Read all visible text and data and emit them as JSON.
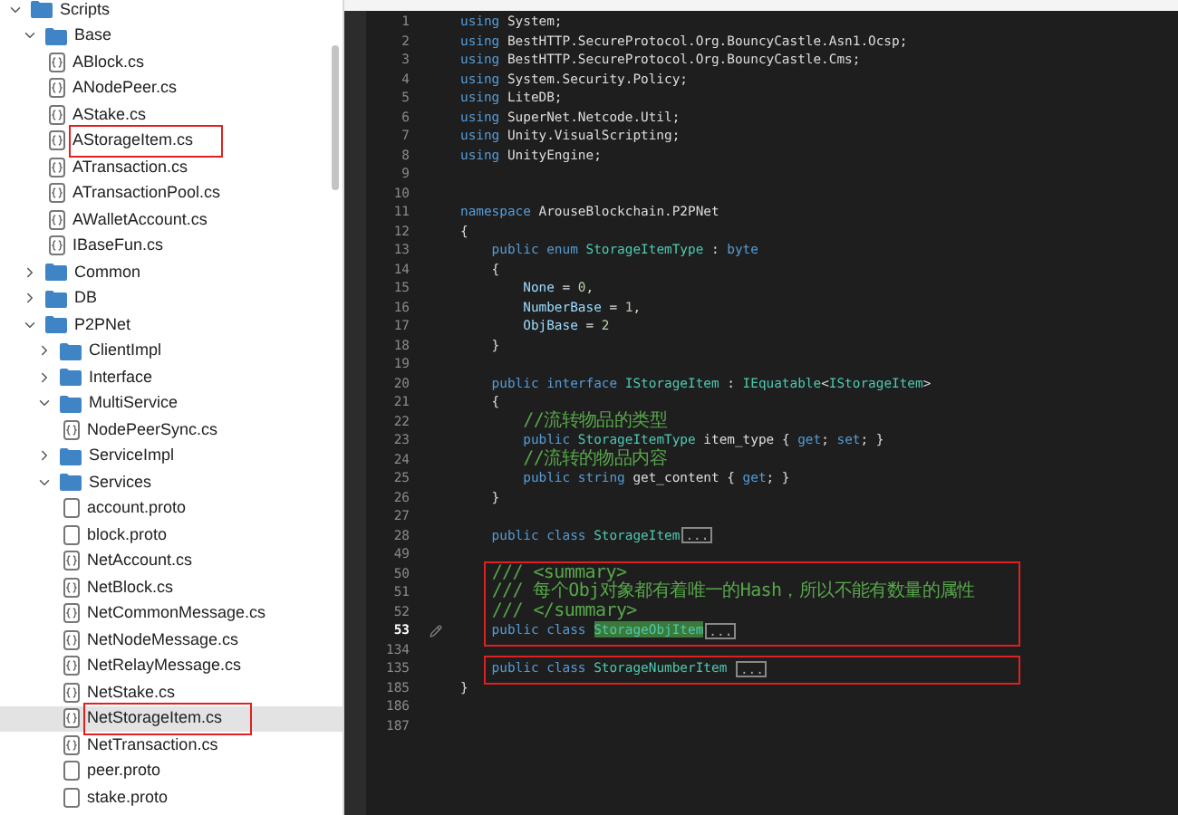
{
  "tree": [
    {
      "label": "Scripts",
      "kind": "folder",
      "expanded": true,
      "selected": false,
      "boxed": false,
      "children": [
        {
          "label": "Base",
          "kind": "folder",
          "expanded": true,
          "selected": false,
          "boxed": false,
          "children": [
            {
              "label": "ABlock.cs",
              "kind": "cs",
              "selected": false,
              "boxed": false
            },
            {
              "label": "ANodePeer.cs",
              "kind": "cs",
              "selected": false,
              "boxed": false
            },
            {
              "label": "AStake.cs",
              "kind": "cs",
              "selected": false,
              "boxed": false
            },
            {
              "label": "AStorageItem.cs",
              "kind": "cs",
              "selected": false,
              "boxed": true
            },
            {
              "label": "ATransaction.cs",
              "kind": "cs",
              "selected": false,
              "boxed": false
            },
            {
              "label": "ATransactionPool.cs",
              "kind": "cs",
              "selected": false,
              "boxed": false
            },
            {
              "label": "AWalletAccount.cs",
              "kind": "cs",
              "selected": false,
              "boxed": false
            },
            {
              "label": "IBaseFun.cs",
              "kind": "cs",
              "selected": false,
              "boxed": false
            }
          ]
        },
        {
          "label": "Common",
          "kind": "folder",
          "expanded": false,
          "selected": false,
          "boxed": false
        },
        {
          "label": "DB",
          "kind": "folder",
          "expanded": false,
          "selected": false,
          "boxed": false
        },
        {
          "label": "P2PNet",
          "kind": "folder",
          "expanded": true,
          "selected": false,
          "boxed": false,
          "children": [
            {
              "label": "ClientImpl",
              "kind": "folder",
              "expanded": false,
              "selected": false,
              "boxed": false
            },
            {
              "label": "Interface",
              "kind": "folder",
              "expanded": false,
              "selected": false,
              "boxed": false
            },
            {
              "label": "MultiService",
              "kind": "folder",
              "expanded": true,
              "selected": false,
              "boxed": false,
              "children": [
                {
                  "label": "NodePeerSync.cs",
                  "kind": "cs",
                  "selected": false,
                  "boxed": false
                }
              ]
            },
            {
              "label": "ServiceImpl",
              "kind": "folder",
              "expanded": false,
              "selected": false,
              "boxed": false
            },
            {
              "label": "Services",
              "kind": "folder",
              "expanded": true,
              "selected": false,
              "boxed": false,
              "children": [
                {
                  "label": "account.proto",
                  "kind": "proto",
                  "selected": false,
                  "boxed": false
                },
                {
                  "label": "block.proto",
                  "kind": "proto",
                  "selected": false,
                  "boxed": false
                },
                {
                  "label": "NetAccount.cs",
                  "kind": "cs",
                  "selected": false,
                  "boxed": false
                },
                {
                  "label": "NetBlock.cs",
                  "kind": "cs",
                  "selected": false,
                  "boxed": false
                },
                {
                  "label": "NetCommonMessage.cs",
                  "kind": "cs",
                  "selected": false,
                  "boxed": false
                },
                {
                  "label": "NetNodeMessage.cs",
                  "kind": "cs",
                  "selected": false,
                  "boxed": false
                },
                {
                  "label": "NetRelayMessage.cs",
                  "kind": "cs",
                  "selected": false,
                  "boxed": false
                },
                {
                  "label": "NetStake.cs",
                  "kind": "cs",
                  "selected": false,
                  "boxed": false
                },
                {
                  "label": "NetStorageItem.cs",
                  "kind": "cs",
                  "selected": true,
                  "boxed": true
                },
                {
                  "label": "NetTransaction.cs",
                  "kind": "cs",
                  "selected": false,
                  "boxed": false
                },
                {
                  "label": "peer.proto",
                  "kind": "proto",
                  "selected": false,
                  "boxed": false
                },
                {
                  "label": "stake.proto",
                  "kind": "proto",
                  "selected": false,
                  "boxed": false
                }
              ]
            }
          ]
        }
      ]
    }
  ],
  "editor": {
    "blocks": [
      {
        "boxed": false,
        "lines": [
          {
            "number": "1",
            "current": false,
            "tokens": [
              {
                "text": "using",
                "kind": "kw"
              },
              {
                "text": " System;",
                "kind": "plain"
              }
            ]
          },
          {
            "number": "2",
            "current": false,
            "tokens": [
              {
                "text": "using",
                "kind": "kw"
              },
              {
                "text": " BestHTTP.SecureProtocol.Org.BouncyCastle.Asn1.Ocsp;",
                "kind": "plain"
              }
            ]
          },
          {
            "number": "3",
            "current": false,
            "tokens": [
              {
                "text": "using",
                "kind": "kw"
              },
              {
                "text": " BestHTTP.SecureProtocol.Org.BouncyCastle.Cms;",
                "kind": "plain"
              }
            ]
          },
          {
            "number": "4",
            "current": false,
            "tokens": [
              {
                "text": "using",
                "kind": "kw"
              },
              {
                "text": " System.Security.Policy;",
                "kind": "plain"
              }
            ]
          },
          {
            "number": "5",
            "current": false,
            "tokens": [
              {
                "text": "using",
                "kind": "kw"
              },
              {
                "text": " LiteDB;",
                "kind": "plain"
              }
            ]
          },
          {
            "number": "6",
            "current": false,
            "tokens": [
              {
                "text": "using",
                "kind": "kw"
              },
              {
                "text": " SuperNet.Netcode.Util;",
                "kind": "plain"
              }
            ]
          },
          {
            "number": "7",
            "current": false,
            "tokens": [
              {
                "text": "using",
                "kind": "kw"
              },
              {
                "text": " Unity.VisualScripting;",
                "kind": "plain"
              }
            ]
          },
          {
            "number": "8",
            "current": false,
            "tokens": [
              {
                "text": "using",
                "kind": "kw"
              },
              {
                "text": " UnityEngine;",
                "kind": "plain"
              }
            ]
          },
          {
            "number": "9",
            "current": false
          },
          {
            "number": "10",
            "current": false
          },
          {
            "number": "11",
            "current": false,
            "tokens": [
              {
                "text": "namespace",
                "kind": "kw"
              },
              {
                "text": " ArouseBlockchain.P2PNet",
                "kind": "plain"
              }
            ]
          },
          {
            "number": "12",
            "current": false,
            "tokens": [
              {
                "text": "{",
                "kind": "plain"
              }
            ]
          },
          {
            "number": "13",
            "current": false,
            "tokens": [
              {
                "text": "    public enum",
                "kind": "kw"
              },
              {
                "text": " StorageItemType",
                "kind": "type"
              },
              {
                "text": " : ",
                "kind": "plain"
              },
              {
                "text": "byte",
                "kind": "kw"
              }
            ]
          },
          {
            "number": "14",
            "current": false,
            "tokens": [
              {
                "text": "    {",
                "kind": "plain"
              }
            ]
          },
          {
            "number": "15",
            "current": false,
            "tokens": [
              {
                "text": "        None",
                "kind": "member"
              },
              {
                "text": " = ",
                "kind": "plain"
              },
              {
                "text": "0",
                "kind": "num"
              },
              {
                "text": ",",
                "kind": "plain"
              }
            ]
          },
          {
            "number": "16",
            "current": false,
            "tokens": [
              {
                "text": "        NumberBase",
                "kind": "member"
              },
              {
                "text": " = ",
                "kind": "plain"
              },
              {
                "text": "1",
                "kind": "num"
              },
              {
                "text": ",",
                "kind": "plain"
              }
            ]
          },
          {
            "number": "17",
            "current": false,
            "tokens": [
              {
                "text": "        ObjBase",
                "kind": "member"
              },
              {
                "text": " = ",
                "kind": "plain"
              },
              {
                "text": "2",
                "kind": "num"
              }
            ]
          },
          {
            "number": "18",
            "current": false,
            "tokens": [
              {
                "text": "    }",
                "kind": "plain"
              }
            ]
          },
          {
            "number": "19",
            "current": false
          },
          {
            "number": "20",
            "current": false,
            "tokens": [
              {
                "text": "    public interface",
                "kind": "kw"
              },
              {
                "text": " IStorageItem",
                "kind": "type"
              },
              {
                "text": " : ",
                "kind": "plain"
              },
              {
                "text": "IEquatable",
                "kind": "type"
              },
              {
                "text": "<",
                "kind": "plain"
              },
              {
                "text": "IStorageItem",
                "kind": "type"
              },
              {
                "text": ">",
                "kind": "plain"
              }
            ]
          },
          {
            "number": "21",
            "current": false,
            "tokens": [
              {
                "text": "    {",
                "kind": "plain"
              }
            ]
          },
          {
            "number": "22",
            "current": false,
            "tokens": [
              {
                "text": "        //流转物品的类型",
                "kind": "comment"
              }
            ]
          },
          {
            "number": "23",
            "current": false,
            "tokens": [
              {
                "text": "        public",
                "kind": "kw"
              },
              {
                "text": " StorageItemType",
                "kind": "type"
              },
              {
                "text": " item_type { ",
                "kind": "plain"
              },
              {
                "text": "get",
                "kind": "kw"
              },
              {
                "text": "; ",
                "kind": "plain"
              },
              {
                "text": "set",
                "kind": "kw"
              },
              {
                "text": "; }",
                "kind": "plain"
              }
            ]
          },
          {
            "number": "24",
            "current": false,
            "tokens": [
              {
                "text": "        //流转的物品内容",
                "kind": "comment"
              }
            ]
          },
          {
            "number": "25",
            "current": false,
            "tokens": [
              {
                "text": "        public string",
                "kind": "kw"
              },
              {
                "text": " get_content { ",
                "kind": "plain"
              },
              {
                "text": "get",
                "kind": "kw"
              },
              {
                "text": "; }",
                "kind": "plain"
              }
            ]
          },
          {
            "number": "26",
            "current": false,
            "tokens": [
              {
                "text": "    }",
                "kind": "plain"
              }
            ]
          },
          {
            "number": "27",
            "current": false
          },
          {
            "number": "28",
            "current": false,
            "tokens": [
              {
                "text": "    public class",
                "kind": "kw"
              },
              {
                "text": " StorageItem",
                "kind": "type"
              },
              {
                "text": "...",
                "kind": "fold"
              }
            ]
          },
          {
            "number": "49",
            "current": false
          }
        ]
      },
      {
        "boxed": true,
        "lines": [
          {
            "number": "50",
            "current": false,
            "tokens": [
              {
                "text": "    /// <summary>",
                "kind": "comment"
              }
            ]
          },
          {
            "number": "51",
            "current": false,
            "tokens": [
              {
                "text": "    /// 每个Obj对象都有着唯一的Hash，所以不能有数量的属性",
                "kind": "comment"
              }
            ]
          },
          {
            "number": "52",
            "current": false,
            "tokens": [
              {
                "text": "    /// </summary>",
                "kind": "comment"
              }
            ]
          },
          {
            "number": "53",
            "current": true,
            "tokens": [
              {
                "text": "    public class ",
                "kind": "kw"
              },
              {
                "text": "StorageObjItem",
                "kind": "selection"
              },
              {
                "text": "...",
                "kind": "fold"
              }
            ]
          }
        ]
      },
      {
        "boxed": false,
        "lines": [
          {
            "number": "134",
            "current": false
          }
        ]
      },
      {
        "boxed": true,
        "lines": [
          {
            "number": "135",
            "current": false,
            "tokens": [
              {
                "text": "    public class",
                "kind": "kw"
              },
              {
                "text": " StorageNumberItem ",
                "kind": "type"
              },
              {
                "text": "...",
                "kind": "fold"
              }
            ]
          }
        ]
      },
      {
        "boxed": false,
        "lines": [
          {
            "number": "185",
            "current": false,
            "tokens": [
              {
                "text": "}",
                "kind": "plain"
              }
            ]
          },
          {
            "number": "186",
            "current": false
          },
          {
            "number": "187",
            "current": false
          }
        ]
      }
    ]
  }
}
